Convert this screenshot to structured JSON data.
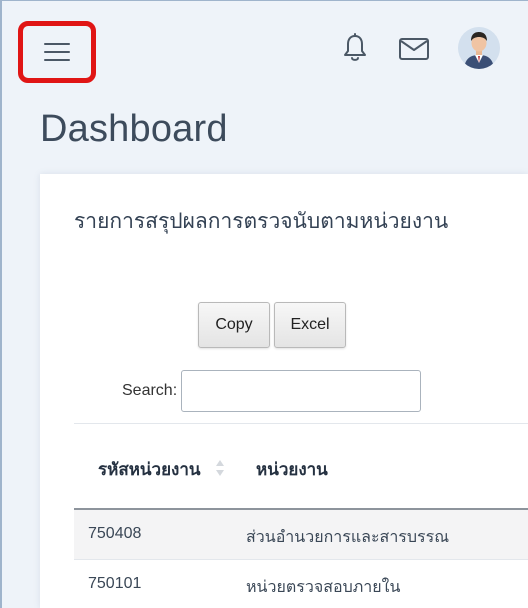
{
  "header": {
    "icons": [
      "hamburger-menu-icon",
      "bell-icon",
      "mail-icon",
      "user-avatar"
    ],
    "highlight_color": "#e01515"
  },
  "page": {
    "title": "Dashboard"
  },
  "card": {
    "title": "รายการสรุปผลการตรวจนับตามหน่วยงาน",
    "buttons": {
      "copy": "Copy",
      "excel": "Excel"
    },
    "search": {
      "label": "Search:",
      "value": ""
    },
    "table": {
      "columns": [
        "รหัสหน่วยงาน",
        "หน่วยงาน"
      ],
      "rows": [
        {
          "code": "750408",
          "unit": "ส่วนอำนวยการและสารบรรณ"
        },
        {
          "code": "750101",
          "unit": "หน่วยตรวจสอบภายใน"
        }
      ]
    }
  }
}
